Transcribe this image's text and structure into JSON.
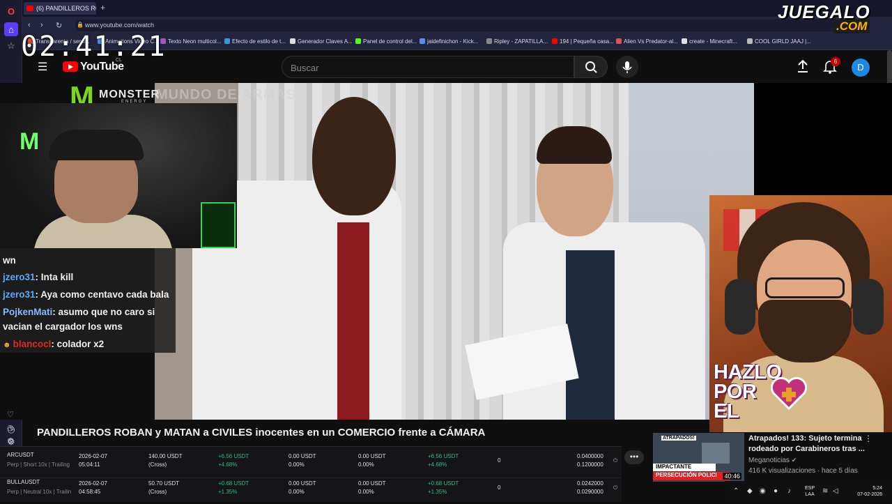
{
  "browser": {
    "tab_title": "(6) PANDILLEROS ROB",
    "url": "www.youtube.com/watch",
    "bookmarks": [
      "Transparenta / semi...",
      "Animations Video C...",
      "Texto Neon multicol...",
      "Efecto de estilo de t...",
      "Generador Claves A...",
      "Panel de control del...",
      "jaidefinichon - Kick...",
      "Ripley - ZAPATILLA...",
      "194 | Pequeña casa...",
      "Alien Vs Predator-al...",
      "create - Minecraft...",
      "COOL GIRLD JAAJ |..."
    ]
  },
  "youtube": {
    "logo_text": "YouTube",
    "country": "CL",
    "search_placeholder": "Buscar",
    "notifications_count": "6",
    "avatar_letter": "D",
    "video_title": "PANDILLEROS ROBAN y MATAN a CIVILES inocentes en un COMERCIO frente a CÁMARA"
  },
  "overlay": {
    "clock": "02:41:21",
    "monster_brand": "MONSTER",
    "monster_sub": "ENERGY",
    "channel_watermark": "MUNDO DE ARMAS",
    "watermark_top": "JUEGALO",
    "watermark_bottom": ".COM",
    "hazlo_text_1": "HAZLO",
    "hazlo_text_2": "POR",
    "hazlo_text_3": "EL"
  },
  "chat": {
    "messages": [
      {
        "user": "",
        "text": "wn"
      },
      {
        "user": "jzero31",
        "text": ": Inta kill"
      },
      {
        "user": "jzero31",
        "text": ": Aya como centavo cada bala"
      },
      {
        "user": "PojkenMati",
        "text": ": asumo que no caro si"
      },
      {
        "user": "",
        "text": "vacian el cargador los wns"
      },
      {
        "user": "blancocl",
        "text": ": colador x2"
      }
    ],
    "user_colors": {
      "jzero31": "#5aa9ff",
      "PojkenMati": "#8fb8ff",
      "blancocl": "#e02a2a"
    }
  },
  "trading": {
    "rows": [
      {
        "symbol": "ARCUSDT",
        "sub": "Perp | Short 10x | Trailing",
        "date": "2026-02-07",
        "time": "05:04:11",
        "margin": "140.00 USDT",
        "margin_sub": "(Cross)",
        "pnl": "+6.56 USDT",
        "pnl_pct": "+4.68%",
        "c1": "0.00 USDT",
        "c1_pct": "0.00%",
        "c2": "0.00 USDT",
        "c2_pct": "0.00%",
        "total": "+6.56 USDT",
        "total_pct": "+4.68%",
        "zero": "0",
        "price1": "0.0400000",
        "price2": "0.1200000"
      },
      {
        "symbol": "BULLAUSDT",
        "sub": "Perp | Neutral 10x | Trailin",
        "date": "2026-02-07",
        "time": "04:58:45",
        "margin": "50.70 USDT",
        "margin_sub": "(Cross)",
        "pnl": "+0.68 USDT",
        "pnl_pct": "+1.35%",
        "c1": "0.00 USDT",
        "c1_pct": "0.00%",
        "c2": "0.00 USDT",
        "c2_pct": "0.00%",
        "total": "+0.68 USDT",
        "total_pct": "+1.35%",
        "zero": "0",
        "price1": "0.0242000",
        "price2": "0.0290000"
      }
    ]
  },
  "recommended": {
    "thumb_tag": "ATRAPADOS!",
    "thumb_band1": "IMPACTANTE",
    "thumb_band2": "PERSECUCIÓN POLICI",
    "duration": "40:46",
    "title": "Atrapados! 133: Sujeto termina rodeado por Carabineros tras ...",
    "channel": "Meganoticias",
    "meta": "416 K visualizaciones · hace 5 días"
  },
  "tray": {
    "lang_1": "ESP",
    "lang_2": "LAA",
    "time": "5:24",
    "date": "07-02-2026"
  },
  "colors": {
    "youtube_red": "#ff0000",
    "pnl_green": "#2ebd85",
    "monster_green": "#7ed321",
    "juegalo_orange": "#ffb400"
  }
}
